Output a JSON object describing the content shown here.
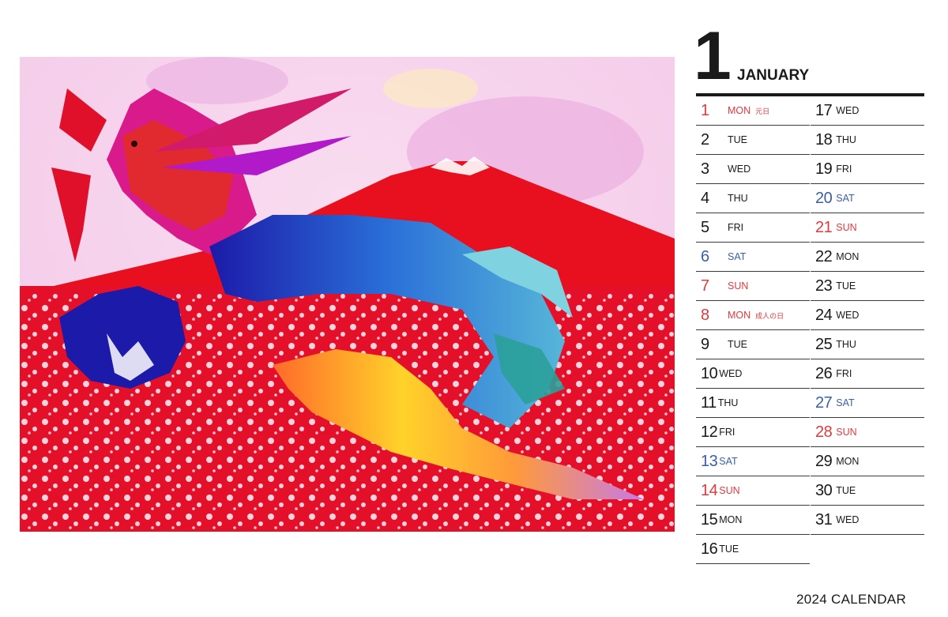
{
  "header": {
    "month_number": "1",
    "month_name": "JANUARY"
  },
  "footer": {
    "text": "2024 CALENDAR"
  },
  "colors": {
    "holiday_red": "#e03a3e",
    "saturday_blue": "#3a5fa8",
    "text": "#1a1a1a"
  },
  "days_left": [
    {
      "num": "1",
      "dow": "MON",
      "holiday": "元日",
      "color": "red"
    },
    {
      "num": "2",
      "dow": "TUE",
      "holiday": "",
      "color": ""
    },
    {
      "num": "3",
      "dow": "WED",
      "holiday": "",
      "color": ""
    },
    {
      "num": "4",
      "dow": "THU",
      "holiday": "",
      "color": ""
    },
    {
      "num": "5",
      "dow": "FRI",
      "holiday": "",
      "color": ""
    },
    {
      "num": "6",
      "dow": "SAT",
      "holiday": "",
      "color": "blue"
    },
    {
      "num": "7",
      "dow": "SUN",
      "holiday": "",
      "color": "red"
    },
    {
      "num": "8",
      "dow": "MON",
      "holiday": "成人の日",
      "color": "red"
    },
    {
      "num": "9",
      "dow": "TUE",
      "holiday": "",
      "color": ""
    },
    {
      "num": "10",
      "dow": "WED",
      "holiday": "",
      "color": ""
    },
    {
      "num": "11",
      "dow": "THU",
      "holiday": "",
      "color": ""
    },
    {
      "num": "12",
      "dow": "FRI",
      "holiday": "",
      "color": ""
    },
    {
      "num": "13",
      "dow": "SAT",
      "holiday": "",
      "color": "blue"
    },
    {
      "num": "14",
      "dow": "SUN",
      "holiday": "",
      "color": "red"
    },
    {
      "num": "15",
      "dow": "MON",
      "holiday": "",
      "color": ""
    },
    {
      "num": "16",
      "dow": "TUE",
      "holiday": "",
      "color": ""
    }
  ],
  "days_right": [
    {
      "num": "17",
      "dow": "WED",
      "holiday": "",
      "color": ""
    },
    {
      "num": "18",
      "dow": "THU",
      "holiday": "",
      "color": ""
    },
    {
      "num": "19",
      "dow": "FRI",
      "holiday": "",
      "color": ""
    },
    {
      "num": "20",
      "dow": "SAT",
      "holiday": "",
      "color": "blue"
    },
    {
      "num": "21",
      "dow": "SUN",
      "holiday": "",
      "color": "red"
    },
    {
      "num": "22",
      "dow": "MON",
      "holiday": "",
      "color": ""
    },
    {
      "num": "23",
      "dow": "TUE",
      "holiday": "",
      "color": ""
    },
    {
      "num": "24",
      "dow": "WED",
      "holiday": "",
      "color": ""
    },
    {
      "num": "25",
      "dow": "THU",
      "holiday": "",
      "color": ""
    },
    {
      "num": "26",
      "dow": "FRI",
      "holiday": "",
      "color": ""
    },
    {
      "num": "27",
      "dow": "SAT",
      "holiday": "",
      "color": "blue"
    },
    {
      "num": "28",
      "dow": "SUN",
      "holiday": "",
      "color": "red"
    },
    {
      "num": "29",
      "dow": "MON",
      "holiday": "",
      "color": ""
    },
    {
      "num": "30",
      "dow": "TUE",
      "holiday": "",
      "color": ""
    },
    {
      "num": "31",
      "dow": "WED",
      "holiday": "",
      "color": ""
    }
  ],
  "artwork": {
    "subject": "dragon-over-red-fuji-painting"
  }
}
